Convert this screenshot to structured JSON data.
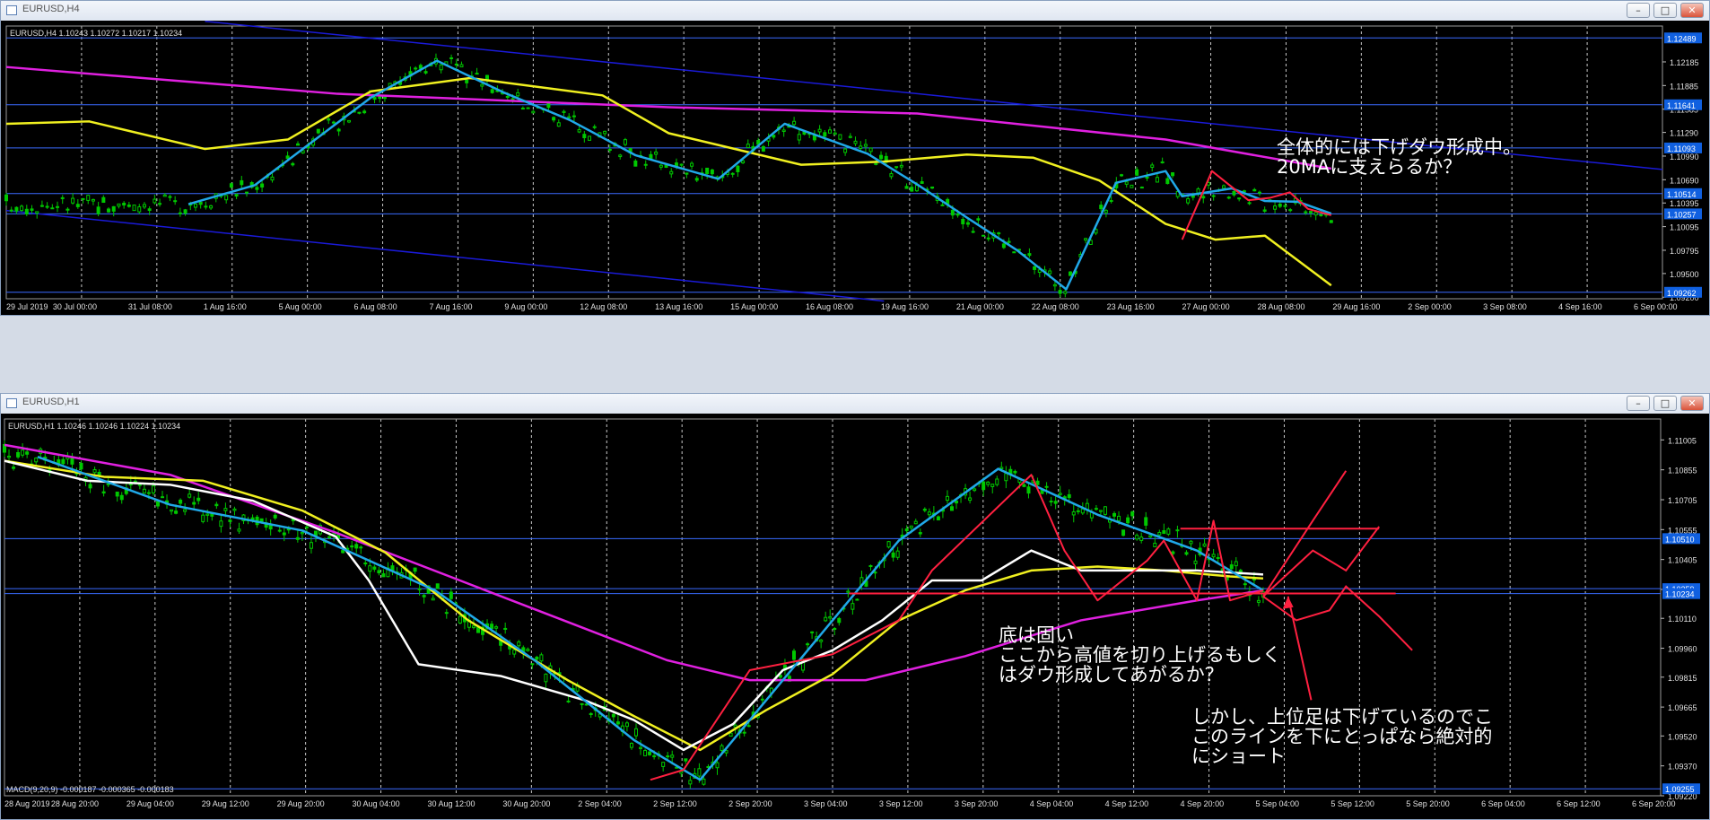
{
  "colors": {
    "background": "#000000",
    "grid": "#c8c8c8",
    "candle": "#00c800",
    "hline": "#3a6bff",
    "trendline": "#1a1ad8",
    "ma_magenta": "#e020e0",
    "ma_yellow": "#f0f020",
    "ma_cyan": "#20a8e8",
    "ma_white": "#ffffff",
    "drawing_red": "#ff2040",
    "price_tag": "#1060e0"
  },
  "top_window": {
    "title": "EURUSD,H4",
    "buttons": [
      "–",
      "□",
      "✕"
    ],
    "header": "EURUSD,H4  1.10243 1.10272 1.10217 1.10234",
    "annotation": [
      "全体的には下げダウ形成中。",
      "20MAに支えらるか？"
    ]
  },
  "bottom_window": {
    "title": "EURUSD,H1",
    "buttons": [
      "–",
      "□",
      "✕"
    ],
    "header": "EURUSD,H1  1.10246 1.10246 1.10224 1.10234",
    "macd_label": "MACD(9,20,9) -0.000187 -0.000365 -0.000183",
    "annotation1": [
      "底は固い",
      "ここから高値を切り上げるもしく",
      "はダウ形成してあがるか？"
    ],
    "annotation2": [
      "しかし、上位足は下げているのでこ",
      "このラインを下にとっぱなら絶対的",
      "にショート"
    ]
  },
  "chart_data": [
    {
      "type": "candlestick",
      "title": "EURUSD,H4",
      "ylim": [
        1.0918,
        1.1264
      ],
      "y_ticks": [
        "1.12185",
        "1.11885",
        "1.11585",
        "1.11290",
        "1.10990",
        "1.10690",
        "1.10395",
        "1.10095",
        "1.09795",
        "1.09500",
        "1.09200"
      ],
      "y_tags": [
        "1.12489",
        "1.11641",
        "1.11093",
        "1.10514",
        "1.10257",
        "1.09262"
      ],
      "x_labels": [
        "29 Jul 2019",
        "30 Jul 00:00",
        "31 Jul 08:00",
        "1 Aug 16:00",
        "5 Aug 00:00",
        "6 Aug 08:00",
        "7 Aug 16:00",
        "9 Aug 00:00",
        "12 Aug 08:00",
        "13 Aug 16:00",
        "15 Aug 00:00",
        "16 Aug 08:00",
        "19 Aug 16:00",
        "21 Aug 00:00",
        "22 Aug 08:00",
        "23 Aug 16:00",
        "27 Aug 00:00",
        "28 Aug 08:00",
        "29 Aug 16:00",
        "2 Sep 00:00",
        "3 Sep 08:00",
        "4 Sep 16:00",
        "6 Sep 00:00"
      ],
      "horizontal_lines": [
        1.12489,
        1.11641,
        1.11093,
        1.10514,
        1.10257,
        1.09262
      ],
      "series": [
        {
          "style": "ma_magenta",
          "x": [
            0,
            0.2,
            0.4,
            0.55,
            0.7,
            0.8
          ],
          "y": [
            1.1212,
            1.1178,
            1.1161,
            1.1153,
            1.112,
            1.1083
          ]
        },
        {
          "style": "ma_yellow",
          "x": [
            0,
            0.05,
            0.12,
            0.17,
            0.22,
            0.28,
            0.36,
            0.4,
            0.48,
            0.53,
            0.58,
            0.62,
            0.66,
            0.7,
            0.73,
            0.76,
            0.8
          ],
          "y": [
            1.114,
            1.1143,
            1.1108,
            1.112,
            1.1181,
            1.1198,
            1.1176,
            1.1128,
            1.1088,
            1.1092,
            1.1101,
            1.1097,
            1.1068,
            1.1013,
            1.0993,
            1.0998,
            1.0935
          ]
        },
        {
          "style": "ma_cyan",
          "x": [
            0.11,
            0.15,
            0.22,
            0.26,
            0.3,
            0.34,
            0.38,
            0.43,
            0.47,
            0.52,
            0.55,
            0.58,
            0.61,
            0.64,
            0.67,
            0.7,
            0.71,
            0.74,
            0.76,
            0.78,
            0.8
          ],
          "y": [
            1.1038,
            1.1062,
            1.1173,
            1.122,
            1.118,
            1.1145,
            1.11,
            1.107,
            1.114,
            1.1102,
            1.1063,
            1.1021,
            1.098,
            1.093,
            1.1065,
            1.108,
            1.1048,
            1.1058,
            1.1042,
            1.1041,
            1.1026
          ]
        },
        {
          "style": "drawing_red",
          "x": [
            0.71,
            0.728,
            0.75,
            0.763,
            0.775,
            0.786,
            0.8
          ],
          "y": [
            1.0993,
            1.108,
            1.1043,
            1.1046,
            1.1053,
            1.1032,
            1.1024
          ]
        }
      ],
      "trendlines": [
        {
          "from": [
            0.12,
            1.127
          ],
          "to": [
            1.0,
            1.1082
          ]
        },
        {
          "from": [
            0,
            1.103
          ],
          "to": [
            0.53,
            1.0915
          ]
        }
      ]
    },
    {
      "type": "candlestick",
      "title": "EURUSD,H1",
      "ylim": [
        1.0922,
        1.1111
      ],
      "y_ticks": [
        "1.11005",
        "1.10855",
        "1.10705",
        "1.10555",
        "1.10405",
        "1.10255",
        "1.10110",
        "1.09960",
        "1.09815",
        "1.09665",
        "1.09520",
        "1.09370",
        "1.09220"
      ],
      "y_tags": [
        "1.10510",
        "1.10259",
        "1.10234",
        "1.09255"
      ],
      "x_labels": [
        "28 Aug 2019",
        "28 Aug 20:00",
        "29 Aug 04:00",
        "29 Aug 12:00",
        "29 Aug 20:00",
        "30 Aug 04:00",
        "30 Aug 12:00",
        "30 Aug 20:00",
        "2 Sep 04:00",
        "2 Sep 12:00",
        "2 Sep 20:00",
        "3 Sep 04:00",
        "3 Sep 12:00",
        "3 Sep 20:00",
        "4 Sep 04:00",
        "4 Sep 12:00",
        "4 Sep 20:00",
        "5 Sep 04:00",
        "5 Sep 12:00",
        "5 Sep 20:00",
        "6 Sep 04:00",
        "6 Sep 12:00",
        "6 Sep 20:00"
      ],
      "horizontal_lines": [
        1.1051,
        1.10259,
        1.10234,
        1.09255
      ],
      "series": [
        {
          "style": "ma_magenta",
          "x": [
            0,
            0.1,
            0.2,
            0.3,
            0.4,
            0.45,
            0.52,
            0.58,
            0.65,
            0.72,
            0.76
          ],
          "y": [
            1.1098,
            1.1083,
            1.1054,
            1.1022,
            1.099,
            1.098,
            1.098,
            1.0992,
            1.101,
            1.102,
            1.1025
          ]
        },
        {
          "style": "ma_yellow",
          "x": [
            0,
            0.06,
            0.12,
            0.18,
            0.23,
            0.28,
            0.34,
            0.38,
            0.42,
            0.46,
            0.5,
            0.54,
            0.58,
            0.62,
            0.66,
            0.7,
            0.74,
            0.76
          ],
          "y": [
            1.109,
            1.1082,
            1.108,
            1.1065,
            1.1044,
            1.101,
            1.098,
            1.0962,
            1.0945,
            1.0965,
            1.0983,
            1.101,
            1.1025,
            1.1035,
            1.1037,
            1.1035,
            1.1032,
            1.1031
          ]
        },
        {
          "style": "ma_white",
          "x": [
            0,
            0.05,
            0.1,
            0.15,
            0.2,
            0.22,
            0.25,
            0.3,
            0.35,
            0.38,
            0.41,
            0.44,
            0.47,
            0.5,
            0.53,
            0.56,
            0.59,
            0.62,
            0.65,
            0.68,
            0.72,
            0.76
          ],
          "y": [
            1.109,
            1.108,
            1.1078,
            1.107,
            1.1052,
            1.103,
            1.0988,
            1.0982,
            1.097,
            1.096,
            1.0945,
            1.0958,
            1.0985,
            1.0995,
            1.101,
            1.103,
            1.103,
            1.1045,
            1.1035,
            1.1035,
            1.1035,
            1.1033
          ]
        },
        {
          "style": "ma_cyan",
          "x": [
            0.02,
            0.1,
            0.18,
            0.26,
            0.32,
            0.38,
            0.42,
            0.48,
            0.54,
            0.6,
            0.66,
            0.72,
            0.76
          ],
          "y": [
            1.1092,
            1.1068,
            1.1055,
            1.1025,
            1.099,
            1.095,
            1.093,
            1.099,
            1.105,
            1.1086,
            1.1063,
            1.1045,
            1.1025
          ]
        },
        {
          "style": "drawing_red",
          "x": [
            0.39,
            0.41,
            0.45,
            0.5,
            0.54,
            0.56,
            0.62,
            0.64,
            0.66,
            0.69,
            0.7,
            0.72,
            0.73,
            0.74,
            0.76
          ],
          "y": [
            1.093,
            1.0935,
            1.0985,
            1.0993,
            1.101,
            1.1035,
            1.1083,
            1.1045,
            1.102,
            1.104,
            1.105,
            1.102,
            1.106,
            1.102,
            1.1025
          ]
        }
      ],
      "drawings": [
        {
          "kind": "hline",
          "from": [
            0.51,
            1.10235
          ],
          "to": [
            0.84,
            1.10235
          ]
        },
        {
          "kind": "hline",
          "from": [
            0.71,
            1.1056
          ],
          "to": [
            0.83,
            1.1056
          ]
        },
        {
          "kind": "path",
          "x": [
            0.76,
            0.79,
            0.81
          ],
          "y": [
            1.1022,
            1.106,
            1.1085
          ]
        },
        {
          "kind": "path",
          "x": [
            0.76,
            0.79,
            0.8,
            0.81,
            0.83
          ],
          "y": [
            1.1022,
            1.1045,
            1.104,
            1.1035,
            1.1057
          ]
        },
        {
          "kind": "path",
          "x": [
            0.76,
            0.78,
            0.8,
            0.81,
            0.83,
            0.85
          ],
          "y": [
            1.1022,
            1.101,
            1.1015,
            1.1027,
            1.1012,
            1.0995
          ]
        },
        {
          "kind": "arrow",
          "from": [
            0.789,
            1.097
          ],
          "to": [
            0.775,
            1.1022
          ]
        }
      ]
    }
  ]
}
